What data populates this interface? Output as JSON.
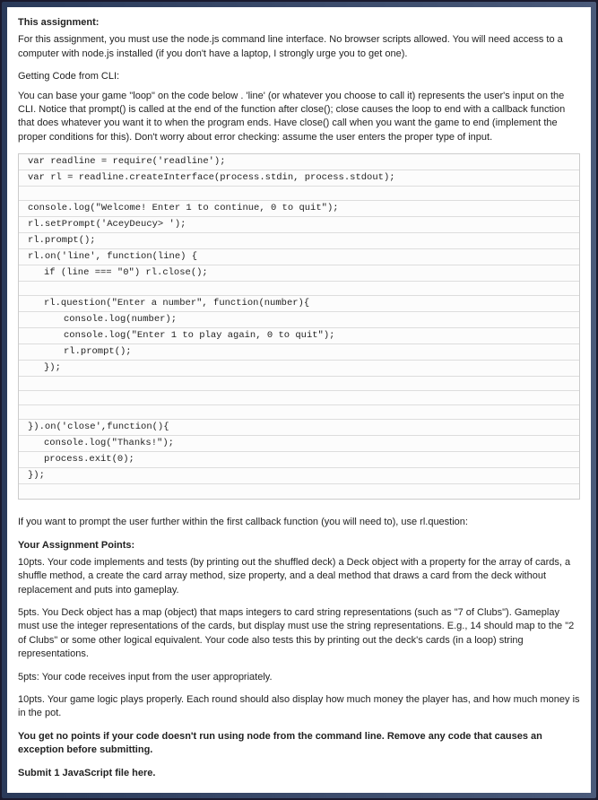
{
  "heading_assignment": "This assignment:",
  "para_intro": "For this assignment, you must use the node.js command line interface. No browser scripts allowed. You will need access to a computer with node.js installed (if you don't have a laptop, I strongly urge you to get one).",
  "heading_getting_code": "Getting Code from CLI:",
  "para_getting_code": "You can base your game \"loop\" on the code below . 'line' (or whatever you choose to call it) represents the user's input on the CLI. Notice that prompt() is called at the end of the function after close(); close causes the loop to end with a callback function that does whatever you want it to when the program ends. Have close() call when you want the game to end (implement the proper conditions for this). Don't worry about error checking: assume the user enters the proper type of input.",
  "code": {
    "l1": "var readline = require('readline');",
    "l2": "var rl = readline.createInterface(process.stdin, process.stdout);",
    "l3": "",
    "l4": "console.log(\"Welcome! Enter 1 to continue, 0 to quit\");",
    "l5": "rl.setPrompt('AceyDeucy> ');",
    "l6": "rl.prompt();",
    "l7": "rl.on('line', function(line) {",
    "l8": "if (line === \"0\") rl.close();",
    "l9": "",
    "l10": "rl.question(\"Enter a number\", function(number){",
    "l11": "console.log(number);",
    "l12": "console.log(\"Enter 1 to play again, 0 to quit\");",
    "l13": "rl.prompt();",
    "l14": "});",
    "l15": "",
    "l16": "",
    "l17": "",
    "l18": "}).on('close',function(){",
    "l19": "console.log(\"Thanks!\");",
    "l20": "process.exit(0);",
    "l21": "});",
    "l22": ""
  },
  "para_after_code": "If you want to prompt the user further within the first callback function (you will need to), use rl.question:",
  "heading_points": "Your Assignment Points:",
  "points_10a": "10pts. Your code implements and tests (by printing out the shuffled deck) a Deck object with a property for the array of cards, a shuffle method, a create the card array method, size property, and a deal method that draws a card from the deck without replacement and puts into gameplay.",
  "points_5a": "5pts. You Deck object has a map (object) that maps integers to card  string representations (such as \"7 of Clubs\"). Gameplay must use the integer representations of the cards, but display must use the string representations. E.g., 14 should map to the \"2 of Clubs\" or some other logical equivalent. Your code also tests this by printing out the deck's cards (in a loop) string representations.",
  "points_5b": "5pts: Your code receives input from the user appropriately.",
  "points_10b": "10pts. Your game logic plays properly. Each round should also display how much money the player has, and how much money is in the pot.",
  "para_warning": "You get no points if your code doesn't run using node from the command line. Remove any code that causes an exception before submitting.",
  "para_submit": "Submit 1 JavaScript file here."
}
